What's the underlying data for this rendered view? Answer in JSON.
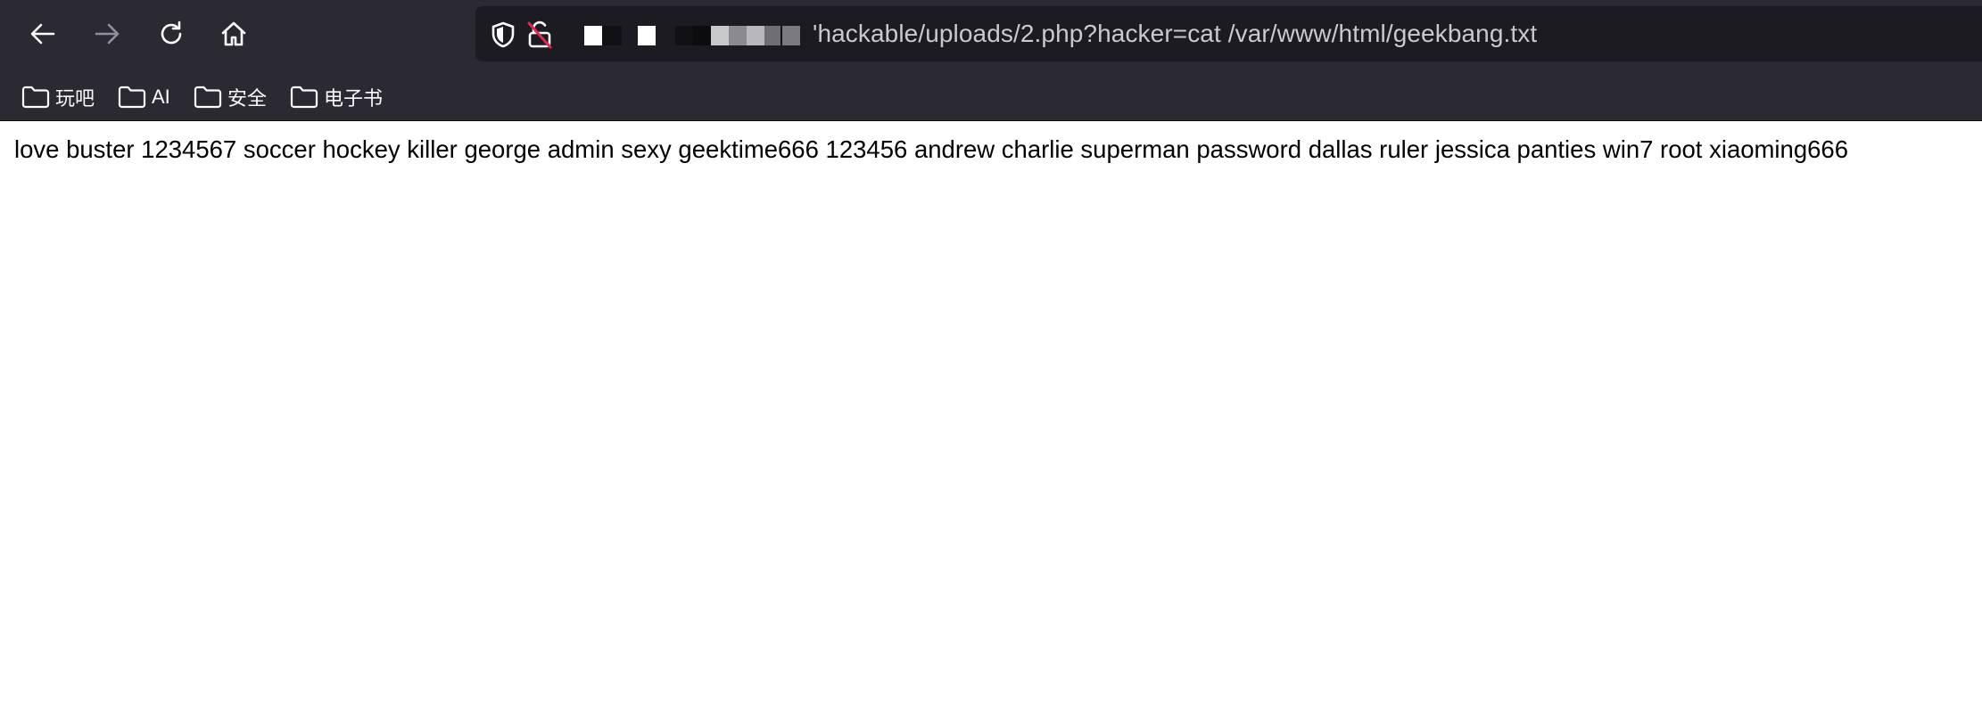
{
  "toolbar": {
    "back_icon": "arrow-left-icon",
    "forward_icon": "arrow-right-icon",
    "reload_icon": "reload-icon",
    "home_icon": "home-icon"
  },
  "urlbar": {
    "tracking_icon": "shield-icon",
    "insecure_icon": "unlocked-insecure-icon",
    "url_visible": "'hackable/uploads/2.php?hacker=cat /var/www/html/geekbang.txt"
  },
  "bookmarks": [
    {
      "label": "玩吧",
      "icon": "folder-icon"
    },
    {
      "label": "AI",
      "icon": "folder-icon"
    },
    {
      "label": "安全",
      "icon": "folder-icon"
    },
    {
      "label": "电子书",
      "icon": "folder-icon"
    }
  ],
  "page": {
    "body_text": "love buster 1234567 soccer hockey killer george admin sexy geektime666 123456 andrew charlie superman password dallas ruler jessica panties win7 root xiaoming666"
  },
  "colors": {
    "chrome_bg": "#2b2a33",
    "urlbar_bg": "#1c1b22",
    "icon_fg": "#fbfbfe",
    "icon_disabled": "#8f8f9d",
    "url_text": "#c9c9cf",
    "insecure_red": "#e22850",
    "page_bg": "#ffffff",
    "page_text": "#000000"
  }
}
